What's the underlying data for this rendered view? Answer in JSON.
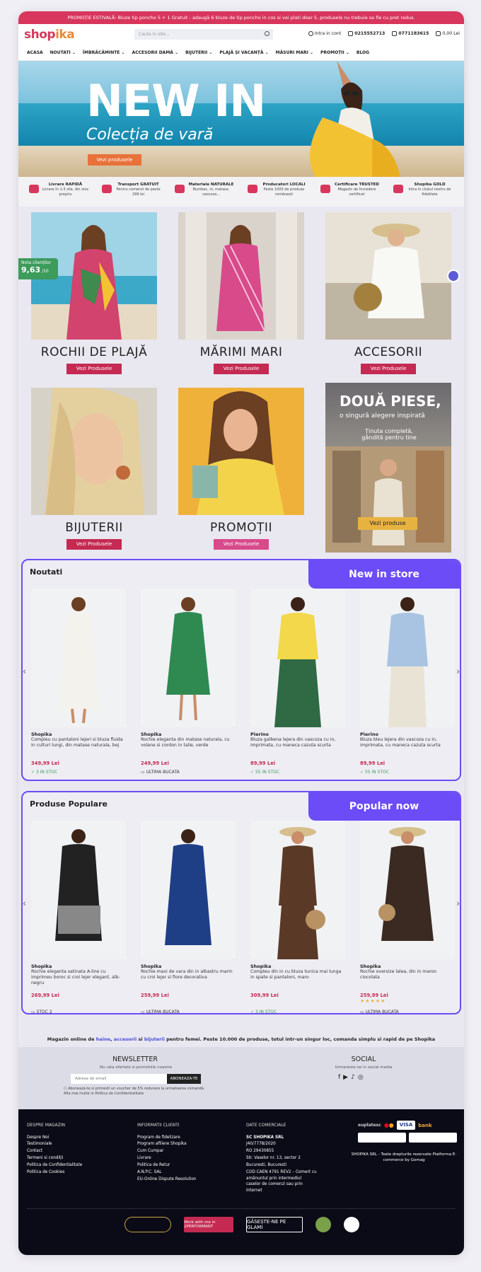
{
  "promo_bar": "PROMOȚIE ESTIVALĂ: Bluze tip poncho 5 + 1 Gratuit - adaugă 6 bluze de tip poncho in cos si vei plati doar 5, produsele nu trebuie sa fie cu pret redus.",
  "header": {
    "logo_main": "shop",
    "logo_accent": "ika",
    "search_placeholder": "Cauta in site...",
    "login": "Intra in cont",
    "phone1": "0215552713",
    "phone2": "0771183615",
    "cart": "0,00 Lei"
  },
  "nav": [
    "ACASA",
    "NOUTATI",
    "ÎMBRĂCĂMINTE",
    "ACCESORII DAMĂ",
    "BIJUTERII",
    "PLAJĂ ȘI VACANȚĂ",
    "MĂSURI MARI",
    "PROMOȚII",
    "BLOG"
  ],
  "hero": {
    "title": "NEW IN",
    "subtitle": "Colecția de vară",
    "cta": "Vezi produsele"
  },
  "usps": [
    {
      "title": "Livrare RAPIDĂ",
      "text": "Livrare în 1-3 zile, din stoc propriu"
    },
    {
      "title": "Transport GRATUIT",
      "text": "Pentru comenzi de peste 299 lei"
    },
    {
      "title": "Materiale NATURALE",
      "text": "Bumbac, in, matase, vascoza..."
    },
    {
      "title": "Producatori LOCALI",
      "text": "Peste 1000 de produse românești"
    },
    {
      "title": "Certificare TRUSTED",
      "text": "Magazin de încredere certificat"
    },
    {
      "title": "Shopika GOLD",
      "text": "Intra in clubul nostru de fidelitate"
    }
  ],
  "rating": {
    "label": "Nota clienților",
    "value": "9,63",
    "suffix": "/10"
  },
  "categories": [
    {
      "label": "ROCHII DE PLAJĂ",
      "button": "Vezi Produsele"
    },
    {
      "label": "MĂRIMI MARI",
      "button": "Vezi Produsele"
    },
    {
      "label": "ACCESORII",
      "button": "Vezi Produsele"
    },
    {
      "label": "BIJUTERII",
      "button": "Vezi Produsele"
    },
    {
      "label": "PROMOȚII",
      "button": "Vezi Produsele"
    }
  ],
  "promo_tile": {
    "title": "DOUĂ PIESE,",
    "subtitle": "o singură alegere inspirată",
    "text": "Ținuta completă, gândită pentru tine",
    "cta": "Vezi produse"
  },
  "noutati": {
    "title": "Noutati",
    "badge": "New in store",
    "products": [
      {
        "brand": "Shopika",
        "desc": "Compleu cu pantaloni lejeri si bluza fluida in culturi lungi, din matase naturala, bej",
        "price": "349,99 Lei",
        "stock": "3 IN STOC"
      },
      {
        "brand": "Shopika",
        "desc": "Rochie eleganta din matase naturala, cu volane si cordon in talie, verde",
        "price": "249,99 Lei",
        "stock": "ULTIMA BUCATA"
      },
      {
        "brand": "Pierino",
        "desc": "Bluza galbena lejera din vascoza cu in, imprimata, cu maneca cazuta scurta",
        "price": "89,99 Lei",
        "stock": "55 IN STOC"
      },
      {
        "brand": "Pierino",
        "desc": "Bluza bleu lejera din vascoza cu in, imprimata, cu maneca cazuta scurta",
        "price": "89,99 Lei",
        "stock": "55 IN STOC"
      }
    ]
  },
  "populare": {
    "title": "Produse Populare",
    "badge": "Popular now",
    "products": [
      {
        "brand": "Shopika",
        "desc": "Rochie eleganta satinata A-line cu imprimeu boroc si croi lejer elegant, alb-negru",
        "price": "269,99 Lei",
        "stock": "STOC 2"
      },
      {
        "brand": "Shopika",
        "desc": "Rochie maxi de vara din in albastru marin cu croi lejer si fiore decorativa",
        "price": "259,99 Lei",
        "stock": "ULTIMA BUCATA"
      },
      {
        "brand": "Shopika",
        "desc": "Compleu din in cu bluza tunica mai lunga in spate si pantaloni, maro",
        "price": "309,99 Lei",
        "stock": "3 IN STOC"
      },
      {
        "brand": "Shopika",
        "desc": "Rochie oversize lalea, din in maron ciocolata",
        "price": "259,99 Lei",
        "stock": "ULTIMA BUCATA"
      }
    ]
  },
  "about": {
    "pre": "Magazin online de ",
    "haine": "haine",
    "sep1": ", ",
    "accesorii": "accesorii",
    "mid": " si ",
    "bijuterii": "bijuterii",
    "post": " pentru femei. Peste 10.000 de produse, totul intr-un singur loc, comanda simplu si rapid de pe Shopika"
  },
  "newsletter": {
    "title": "NEWSLETTER",
    "subtitle": "Nu rata ofertele si promotiile noastre",
    "placeholder": "Adresa de email",
    "button": "ABONEAZA-TE",
    "consent": "Abonează-te si primesti un voucher de 5% reducere la urmatoarea comandă. Afla mai multe in Politica de Confidentialitate"
  },
  "social": {
    "title": "SOCIAL",
    "subtitle": "Urmareste-ne in social media"
  },
  "footer": {
    "col1_title": "DESPRE MAGAZIN",
    "col1": [
      "Despre Noi",
      "Testimoniale",
      "Contact",
      "Termeni si condiții",
      "Politica de Confidentialitate",
      "Politica de Cookies"
    ],
    "col2_title": "INFORMATII CLIENTI",
    "col2": [
      "Program de fidelizare",
      "Program afiliere Shopika",
      "Cum Cumpar",
      "Livrare",
      "Politica de Retur",
      "A.N.P.C. SAL",
      "EU-Online Dispute Resolution"
    ],
    "col3_title": "DATE COMERCIALE",
    "col3": [
      "SC SHOPIKA SRL",
      "J40/7778/2020",
      "RO 29430855",
      "Str. Vaselor nr. 13, sector 2",
      "Bucuresti, Bucuresti",
      "COD CAEN 4791 REV2 – Comert cu amănuntul prin intermediul caselor de comenzi sau prin Internet"
    ],
    "payments": [
      "euplatesc",
      "VISA",
      "bank"
    ],
    "copyright": "SHOPIKA SRL - Toate drepturile rezervate Platforma E-commerce by Gomag",
    "badges": {
      "perf": "Work with me in 2PERFORMANT",
      "glami": "GĂSEȘTE-NE PE GLAMI"
    }
  },
  "colors": {
    "brand": "#d8365c",
    "accent": "#6b4cf6",
    "price": "#c42a52",
    "stock": "#3d9b5c"
  }
}
